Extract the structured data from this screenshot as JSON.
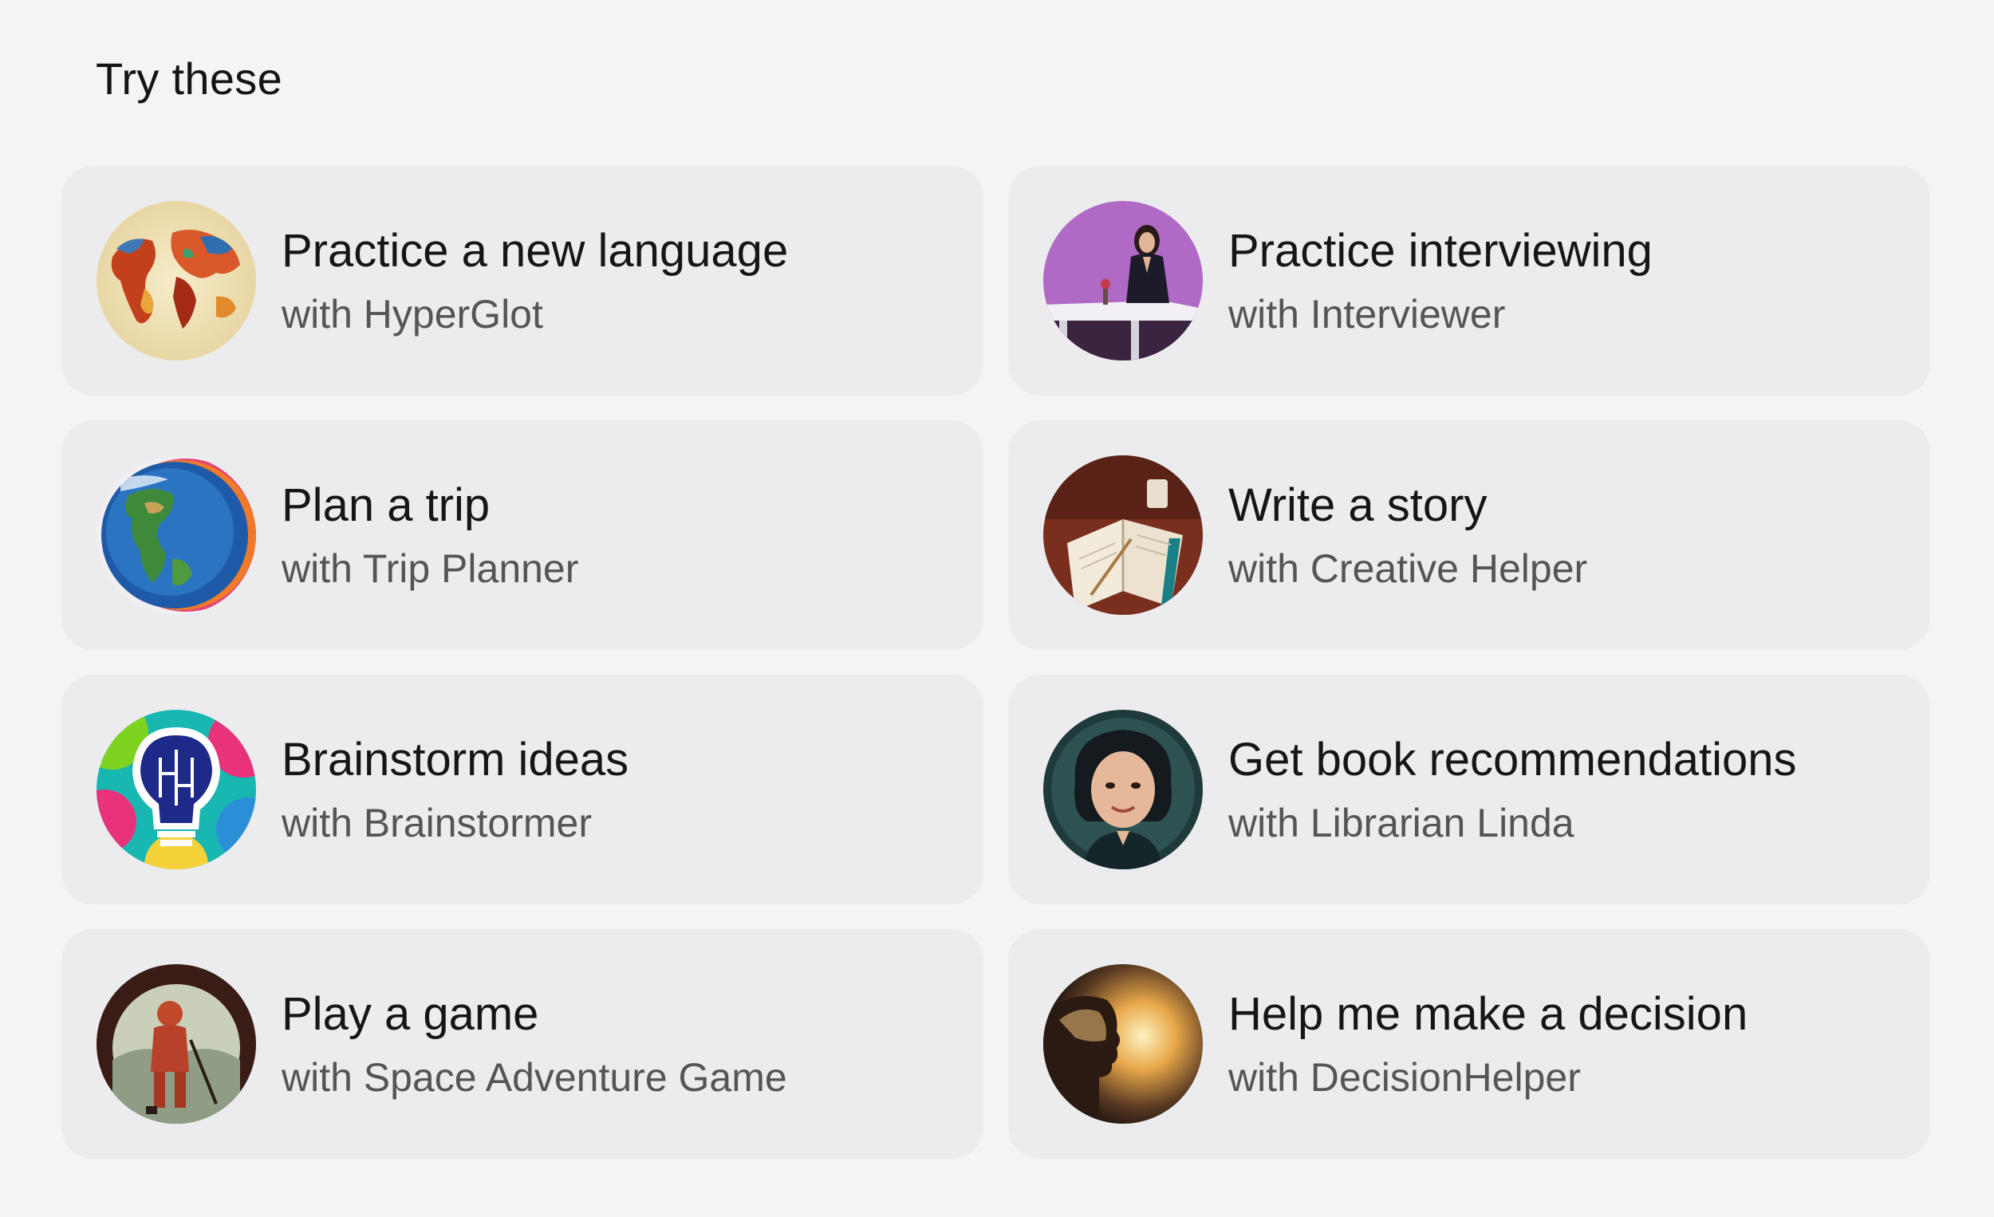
{
  "section": {
    "title": "Try these"
  },
  "suggestions": [
    {
      "title": "Practice a new language",
      "subtitle": "with HyperGlot",
      "icon": "world-map-icon"
    },
    {
      "title": "Practice interviewing",
      "subtitle": "with Interviewer",
      "icon": "interviewer-icon"
    },
    {
      "title": "Plan a trip",
      "subtitle": "with Trip Planner",
      "icon": "globe-icon"
    },
    {
      "title": "Write a story",
      "subtitle": "with Creative Helper",
      "icon": "open-book-icon"
    },
    {
      "title": "Brainstorm ideas",
      "subtitle": "with Brainstormer",
      "icon": "lightbulb-icon"
    },
    {
      "title": "Get book recommendations",
      "subtitle": "with Librarian Linda",
      "icon": "librarian-icon"
    },
    {
      "title": "Play a game",
      "subtitle": "with Space Adventure Game",
      "icon": "astronaut-icon"
    },
    {
      "title": "Help me make a decision",
      "subtitle": "with DecisionHelper",
      "icon": "thinking-head-icon"
    }
  ],
  "colors": {
    "page_background": "#f4f4f4",
    "card_background": "#ececee",
    "title_text": "#161616",
    "subtitle_text": "#555558"
  }
}
